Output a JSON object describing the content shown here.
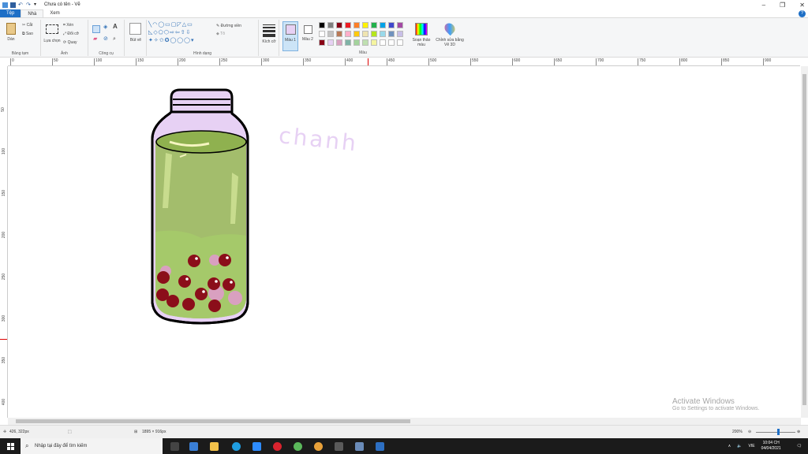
{
  "window": {
    "title": "Chưa có tên - Vẽ",
    "minimize": "–",
    "restore": "❐",
    "close": "✕"
  },
  "tabs": [
    {
      "label": "Tệp"
    },
    {
      "label": "Nhà"
    },
    {
      "label": "Xem"
    }
  ],
  "ribbon": {
    "clipboard": {
      "paste": "Dán",
      "cut": "Cắt",
      "copy": "Sao",
      "label": "Bảng tạm"
    },
    "image": {
      "select": "Lựa chọn",
      "crop": "Xén",
      "resize": "Đổi cỡ",
      "rotate": "Quay",
      "label": "Ảnh"
    },
    "tools": {
      "text": "A",
      "label": "Công cụ"
    },
    "brushes": {
      "label": "Bút vẽ"
    },
    "shapes": {
      "outline": "Đường viền",
      "fill": "Tô",
      "label": "Hình dạng"
    },
    "size": {
      "label": "Kích cỡ"
    },
    "color1": {
      "label": "Màu 1",
      "value": "#e7d1f4"
    },
    "color2": {
      "label": "Màu 2",
      "value": "#ffffff"
    },
    "colors": {
      "label": "Màu"
    },
    "edit_colors": "Soạn thảo màu",
    "paint3d": "Chỉnh sửa bằng Vẽ 3D"
  },
  "palette": [
    "#000000",
    "#7f7f7f",
    "#880015",
    "#ed1c24",
    "#ff7f27",
    "#fff200",
    "#22b14c",
    "#00a2e8",
    "#3f48cc",
    "#a349a4",
    "#ffffff",
    "#c3c3c3",
    "#b97a57",
    "#ffaec9",
    "#ffc90e",
    "#efe4b0",
    "#b5e61d",
    "#99d9ea",
    "#7092be",
    "#c8bfe7",
    "#880015",
    "#e7d1f4",
    "#d9a0c0",
    "#7fb2a6",
    "#a3d39c",
    "#bfe0b0",
    "#f5f5a0",
    "#ffffff",
    "#ffffff",
    "#ffffff"
  ],
  "ruler_h": [
    "0",
    "50",
    "100",
    "150",
    "200",
    "250",
    "300",
    "350",
    "400",
    "450",
    "500",
    "550",
    "600",
    "650",
    "700",
    "750",
    "800",
    "850",
    "900"
  ],
  "ruler_v": [
    "50",
    "100",
    "150",
    "200",
    "250",
    "300",
    "350",
    "400"
  ],
  "canvas": {
    "handwritten_text": "chanh"
  },
  "status": {
    "cursor": "426, 322px",
    "size": "1895 × 916px",
    "zoom": "200%"
  },
  "watermark": {
    "line1": "Activate Windows",
    "line2": "Go to Settings to activate Windows."
  },
  "taskbar": {
    "search_placeholder": "Nhập tại đây để tìm kiếm",
    "time": "10:04 CH",
    "date": "04/04/2021",
    "lang": "VIE"
  }
}
